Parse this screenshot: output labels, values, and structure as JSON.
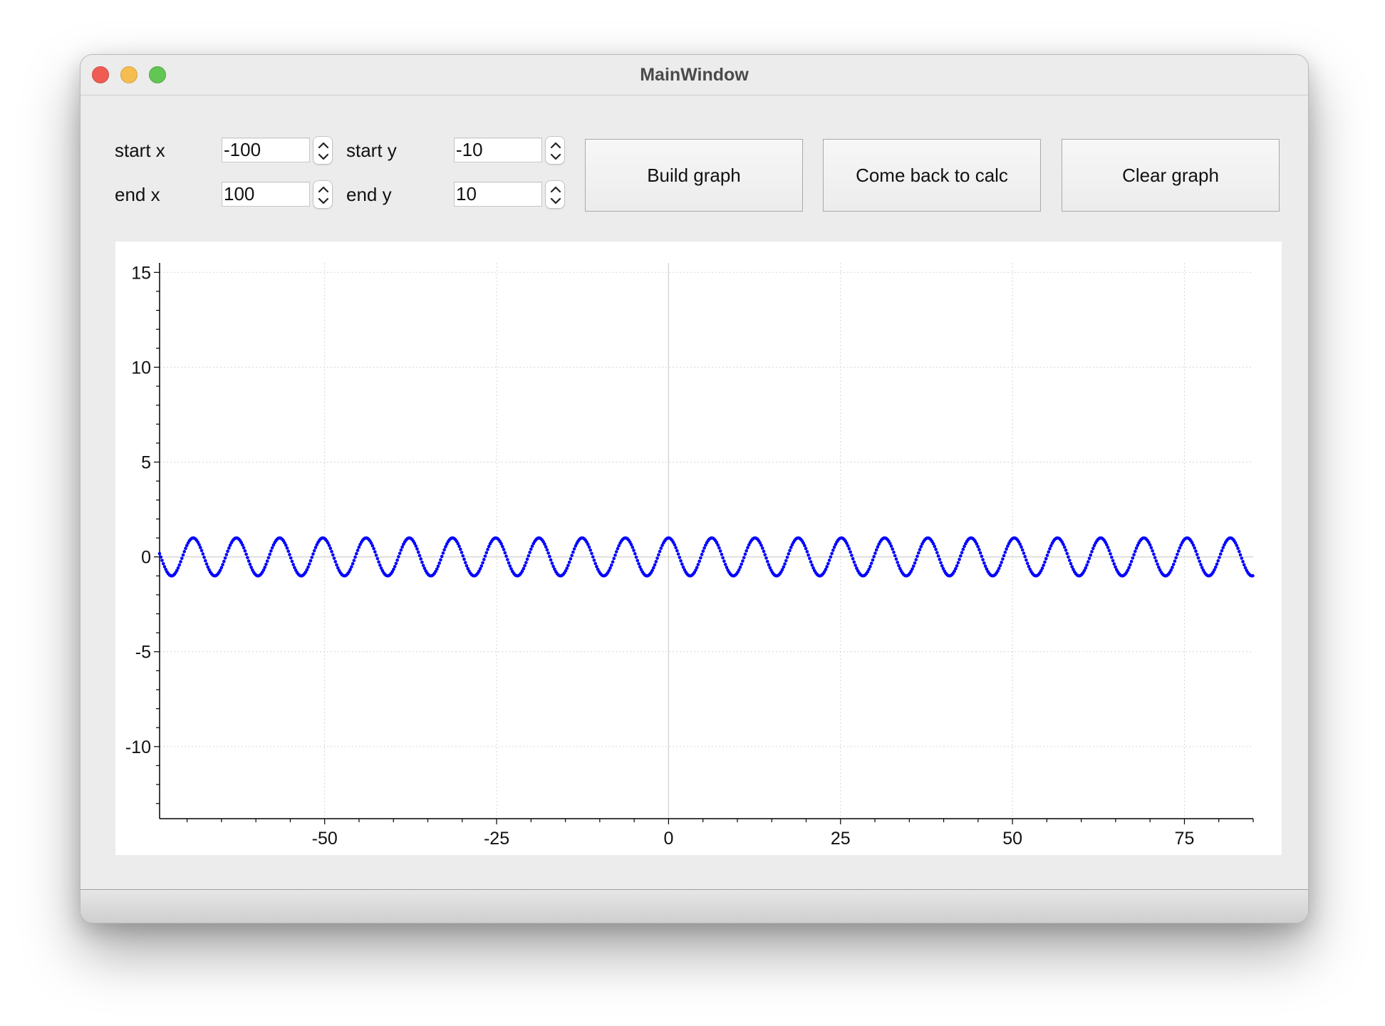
{
  "window": {
    "title": "MainWindow"
  },
  "controls": {
    "start_x": {
      "label": "start x",
      "value": "-100"
    },
    "end_x": {
      "label": "end x",
      "value": "100"
    },
    "start_y": {
      "label": "start y",
      "value": "-10"
    },
    "end_y": {
      "label": "end y",
      "value": "10"
    },
    "build_graph": "Build graph",
    "come_back": "Come back to calc",
    "clear_graph": "Clear graph"
  },
  "chart_data": {
    "type": "scatter",
    "title": "",
    "xlabel": "",
    "ylabel": "",
    "xlim": [
      -74,
      85
    ],
    "ylim": [
      -13.8,
      15.5
    ],
    "x_ticks": [
      -50,
      -25,
      0,
      25,
      50,
      75
    ],
    "x_tick_labels": [
      "-50",
      "-25",
      "0",
      "25",
      "50",
      "75"
    ],
    "y_ticks": [
      15,
      10,
      5,
      0,
      -5,
      -10
    ],
    "y_tick_labels": [
      "15",
      "10",
      "5",
      "0",
      "-5",
      "-10"
    ],
    "grid": true,
    "series": [
      {
        "function": "cos(x)",
        "x_start": -74,
        "x_end": 85,
        "amplitude": 1,
        "period": 6.283,
        "color": "#0000ff"
      }
    ]
  }
}
